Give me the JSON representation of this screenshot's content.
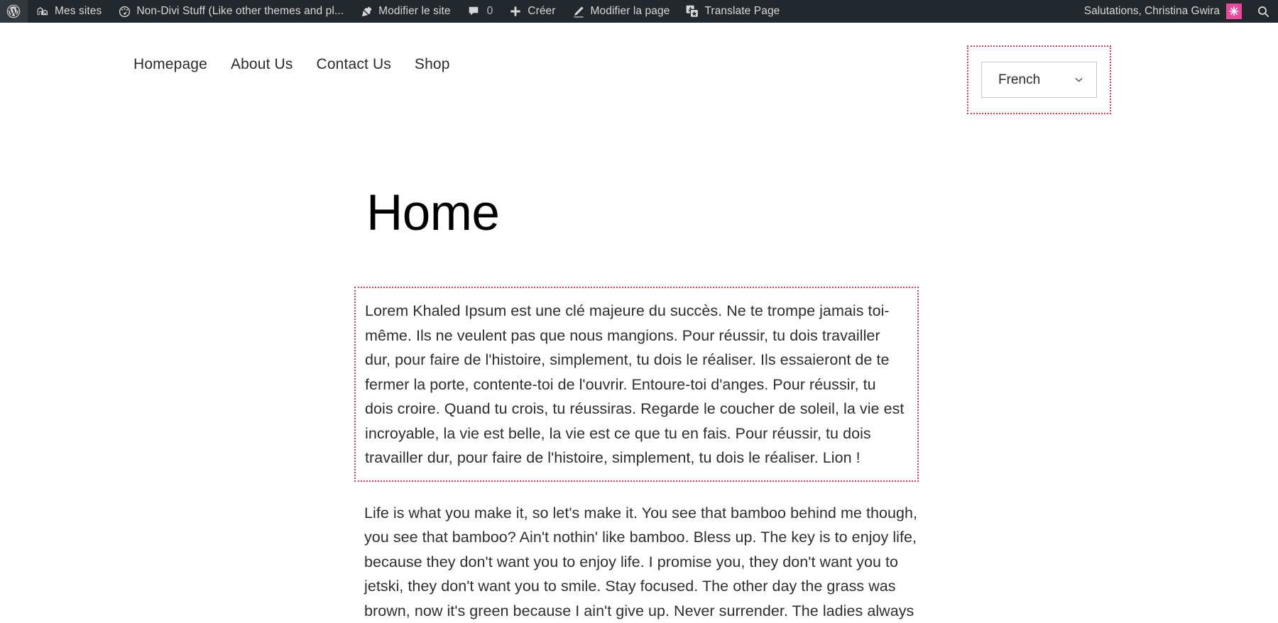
{
  "admin_bar": {
    "background": "#23282d",
    "items": [
      {
        "icon": "wordpress-logo-icon",
        "label": ""
      },
      {
        "icon": "my-sites-icon",
        "label": "Mes sites"
      },
      {
        "icon": "dashboard-icon",
        "label": "Non-Divi Stuff (Like other themes and pl..."
      },
      {
        "icon": "pushpin-icon",
        "label": "Modifier le site"
      },
      {
        "icon": "comment-bubble-icon",
        "label": "",
        "count": "0"
      },
      {
        "icon": "plus-icon",
        "label": "Créer"
      },
      {
        "icon": "pencil-icon",
        "label": "Modifier la page"
      },
      {
        "icon": "translate-icon",
        "label": "Translate Page"
      }
    ],
    "greeting": "Salutations, Christina Gwira",
    "avatar_glyph": "✳",
    "avatar_color": "#e8489e",
    "search_icon": "search-icon"
  },
  "nav": {
    "items": [
      {
        "label": "Homepage"
      },
      {
        "label": "About Us"
      },
      {
        "label": "Contact Us"
      },
      {
        "label": "Shop"
      }
    ]
  },
  "language_switcher": {
    "selected": "French",
    "chevron": "chevron-down-icon",
    "highlight_color": "#e03a52"
  },
  "main": {
    "title": "Home",
    "paragraph_fr": "Lorem Khaled Ipsum est une clé majeure du succès. Ne te trompe jamais toi-même. Ils ne veulent pas que nous mangions. Pour réussir, tu dois travailler dur, pour faire de l'histoire, simplement, tu dois le réaliser. Ils essaieront de te fermer la porte, contente-toi de l'ouvrir. Entoure-toi d'anges. Pour réussir, tu dois croire. Quand tu crois, tu réussiras. Regarde le coucher de soleil, la vie est incroyable, la vie est belle, la vie est ce que tu en fais. Pour réussir, tu dois travailler dur, pour faire de l'histoire, simplement, tu dois le réaliser. Lion !",
    "paragraph_en": "Life is what you make it, so let's make it. You see that bamboo behind me though, you see that bamboo? Ain't nothin' like bamboo. Bless up. The key is to enjoy life, because they don't want you to enjoy life. I promise you, they don't want you to jetski, they don't want you to smile. Stay focused. The other day the grass was brown, now it's green because I ain't give up. Never surrender. The ladies always"
  }
}
